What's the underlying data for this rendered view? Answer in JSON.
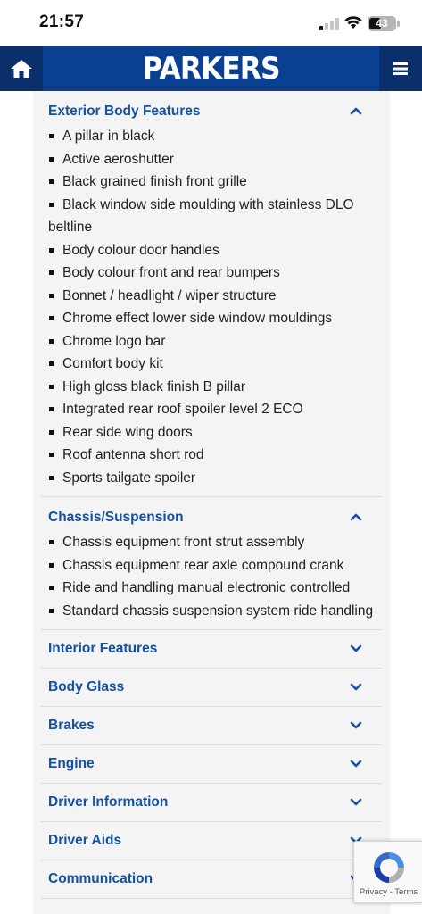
{
  "status_bar": {
    "time": "21:57",
    "battery": "43"
  },
  "header": {
    "brand": "PARKERS",
    "home_icon": "home-icon",
    "menu_icon": "hamburger-menu-icon",
    "brand_color": "#0b3f8f"
  },
  "sections": [
    {
      "title": "Exterior Body Features",
      "expanded": true,
      "items": [
        "A pillar in black",
        "Active aeroshutter",
        "Black grained finish front grille",
        "Black window side moulding with stainless DLO beltline",
        "Body colour door handles",
        "Body colour front and rear bumpers",
        "Bonnet / headlight / wiper structure",
        "Chrome effect lower side window mouldings",
        "Chrome logo bar",
        "Comfort body kit",
        "High gloss black finish B pillar",
        "Integrated rear roof spoiler level 2 ECO",
        "Rear side wing doors",
        "Roof antenna short rod",
        "Sports tailgate spoiler"
      ]
    },
    {
      "title": "Chassis/Suspension",
      "expanded": true,
      "items": [
        "Chassis equipment front strut assembly",
        "Chassis equipment rear axle compound crank",
        "Ride and handling manual electronic controlled",
        "Standard chassis suspension system ride handling"
      ]
    },
    {
      "title": "Interior Features",
      "expanded": false,
      "items": []
    },
    {
      "title": "Body Glass",
      "expanded": false,
      "items": []
    },
    {
      "title": "Brakes",
      "expanded": false,
      "items": []
    },
    {
      "title": "Engine",
      "expanded": false,
      "items": []
    },
    {
      "title": "Driver Information",
      "expanded": false,
      "items": []
    },
    {
      "title": "Driver Aids",
      "expanded": false,
      "items": []
    },
    {
      "title": "Communication",
      "expanded": false,
      "items": []
    }
  ],
  "recaptcha": {
    "terms": "Privacy - Terms"
  },
  "colors": {
    "section_title": "#1450a3",
    "panel_bg": "#f4f4f4"
  }
}
